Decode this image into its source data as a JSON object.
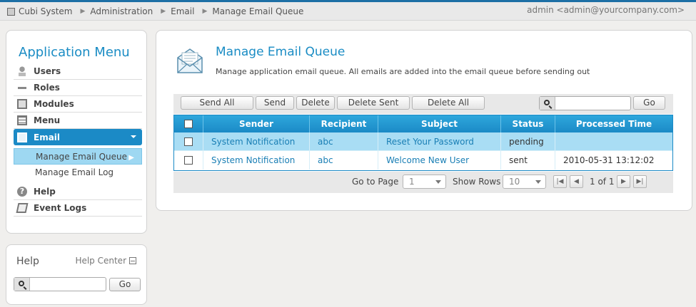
{
  "breadcrumb": {
    "items": [
      "Cubi System",
      "Administration",
      "Email",
      "Manage Email Queue"
    ]
  },
  "user_label": "admin <admin@yourcompany.com>",
  "app_menu": {
    "title": "Application Menu",
    "items": [
      {
        "label": "Users",
        "icon": "users-icon"
      },
      {
        "label": "Roles",
        "icon": "key-icon"
      },
      {
        "label": "Modules",
        "icon": "modules-icon"
      },
      {
        "label": "Menu",
        "icon": "menu-icon"
      },
      {
        "label": "Email",
        "icon": "email-icon"
      },
      {
        "label": "Help",
        "icon": "help-icon"
      },
      {
        "label": "Event Logs",
        "icon": "event-logs-icon"
      }
    ],
    "email_submenu": [
      "Manage Email Queue",
      "Manage Email Log"
    ]
  },
  "help_box": {
    "title": "Help",
    "center_link": "Help Center",
    "go_label": "Go",
    "search_value": ""
  },
  "main": {
    "title": "Manage Email Queue",
    "description": "Manage application email queue. All emails are added into the email queue before sending out",
    "toolbar": {
      "send_all": "Send All",
      "send": "Send",
      "delete": "Delete",
      "delete_sent": "Delete Sent",
      "delete_all": "Delete All",
      "go": "Go",
      "search_value": ""
    },
    "table": {
      "columns": [
        "Sender",
        "Recipient",
        "Subject",
        "Status",
        "Processed Time"
      ],
      "rows": [
        {
          "sender": "System Notification",
          "recipient": "abc",
          "subject": "Reset Your Password",
          "status": "pending",
          "processed_time": ""
        },
        {
          "sender": "System Notification",
          "recipient": "abc",
          "subject": "Welcome New User",
          "status": "sent",
          "processed_time": "2010-05-31 13:12:02"
        }
      ]
    },
    "pager": {
      "go_to_page_label": "Go to Page",
      "page_value": "1",
      "show_rows_label": "Show Rows",
      "rows_value": "10",
      "page_info": "1 of 1"
    }
  },
  "colors": {
    "accent": "#1b8ac6",
    "title": "#1a8cc4",
    "selected_row": "#a9ddf4"
  }
}
